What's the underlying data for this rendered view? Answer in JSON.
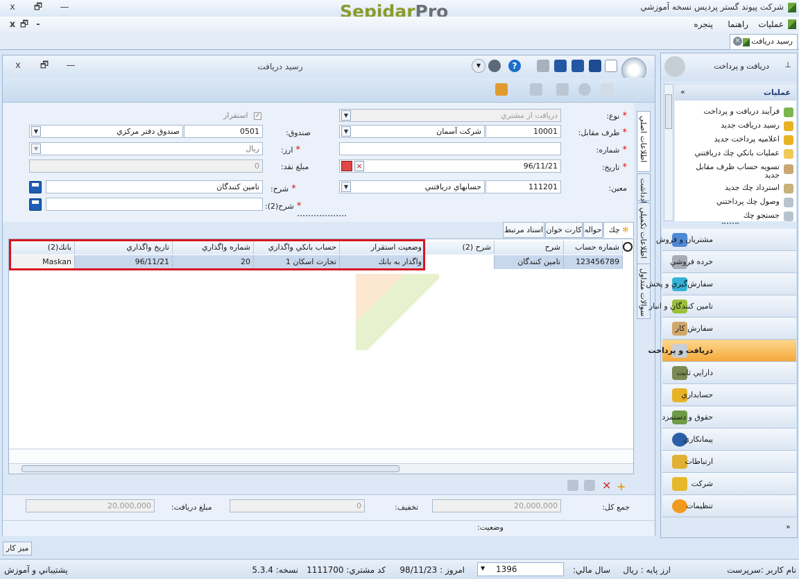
{
  "app": {
    "title": "شرکت پیوند گستر پردیس نسخه آموزشي",
    "logo_left": "Sepidar",
    "logo_right": "Pro",
    "win_buttons": [
      "x",
      "🗗",
      "—"
    ]
  },
  "menubar": {
    "items": [
      "عمليات",
      "راهنما",
      "پنجره"
    ],
    "mdi_buttons": [
      "x",
      "🗗",
      "-"
    ]
  },
  "doc_tab": {
    "label": "رسيد دريافت"
  },
  "window": {
    "title": "رسيد دريافت",
    "buttons": [
      "x",
      "🗗",
      "—"
    ]
  },
  "form": {
    "type_label": "نوع:",
    "type_value": "دريافت از مشتري",
    "counterparty_label": "طرف مقابل:",
    "counterparty_code": "10001",
    "counterparty_name": "شرکت آسمان",
    "number_label": "شماره:",
    "number_value": "",
    "date_label": "تاريخ:",
    "date_value": "96/11/21",
    "moein_label": "معين:",
    "moein_code": "111201",
    "moein_name": "حسابهاي دريافتني",
    "settle_label": "استقرار",
    "fund_label": "صندوق:",
    "fund_code": "0501",
    "fund_name": "صندوق دفتر مرکزي",
    "currency_label": "ارز:",
    "currency_value": "ريال",
    "cash_label": "مبلغ نقد:",
    "cash_value": "0",
    "desc_label": "شرح:",
    "desc_value": "تامين کنندگان",
    "desc2_label": "شرح(2):",
    "desc2_value": ""
  },
  "side_tabs": [
    "اطلاعات اصلي",
    "يادداشت",
    "اطلاعات تکميلي",
    "سوالات متداول"
  ],
  "grid_tabs": [
    "چك",
    "حواله",
    "کارت خوان",
    "اسناد مرتبط"
  ],
  "grid": {
    "columns": [
      "شماره حساب",
      "شرح",
      "شرح (2)",
      "وضعيت استقرار",
      "حساب بانکي واگذاري",
      "شماره واگذاري",
      "تاريخ واگذاري",
      "بانك(2)"
    ],
    "rows": [
      [
        "123456789",
        "تامين کنندگان",
        "",
        "واگذار به بانك",
        "تجارت اسکان 1",
        "20",
        "96/11/21",
        "Maskan"
      ]
    ]
  },
  "totals": {
    "total_label": "جمع کل:",
    "total_value": "20,000,000",
    "discount_label": "تخفيف:",
    "discount_value": "0",
    "received_label": "مبلغ دريافت:",
    "received_value": "20,000,000",
    "status_label": "وضعيت:"
  },
  "sidebar": {
    "header": "دريافت و پرداخت",
    "actions_title": "عمليات",
    "actions": [
      "فرآيند دريافت و پرداخت",
      "رسيد دريافت جديد",
      "اعلاميه پرداخت جديد",
      "عمليات بانکي چك دريافتني",
      "تسويه حساب طرف مقابل",
      "جديد",
      "استرداد چك جديد",
      "وصول چك پرداختني",
      "جستجو چك"
    ],
    "nav": [
      "مشتريان و فروش",
      "خرده فروشي",
      "سفارش‌گيري و پخش",
      "تامين کنندگان و انبار",
      "سفارش کار",
      "دريافت و پرداخت",
      "دارايي ثابت",
      "حسابداري",
      "حقوق و دستمزد",
      "پيمانکاري",
      "ارتباطات",
      "شرکت",
      "تنظيمات"
    ],
    "active_nav": "دريافت و پرداخت"
  },
  "desk_tab": "ميز کار",
  "status": {
    "user_label": "نام کاربر :",
    "user_value": "سرپرست",
    "base_currency_label": "ارز پايه :",
    "base_currency_value": "ريال",
    "fiscal_year_label": "سال مالي:",
    "fiscal_year_value": "1396",
    "today_label": "امروز :",
    "today_value": "98/11/23",
    "customer_code_label": "کد مشتري:",
    "customer_code_value": "1111700",
    "version_label": "نسخه:",
    "version_value": "5.3.4",
    "support": "پشتيباني و آموزش"
  },
  "colors": {
    "accent_orange": "#f5a93c",
    "highlight_red": "#d8141f",
    "selected_row": "#c7d7ec",
    "logo_green": "#8c9a2c"
  }
}
